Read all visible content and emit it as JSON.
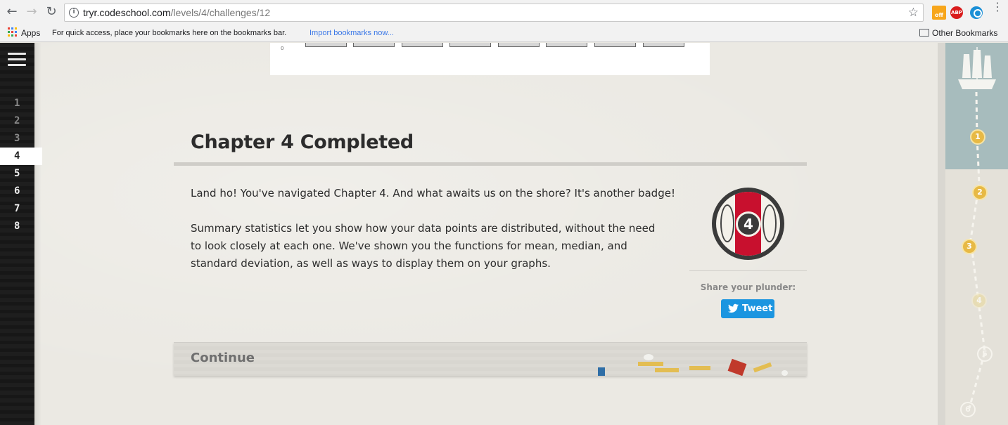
{
  "browser": {
    "url_host": "tryr.codeschool.com",
    "url_path": "/levels/4/challenges/12",
    "ext_off_label": "off",
    "ext_abp_label": "ABP"
  },
  "bookmarks": {
    "apps_label": "Apps",
    "hint": "For quick access, place your bookmarks here on the bookmarks bar.",
    "import_link": "Import bookmarks now...",
    "other": "Other Bookmarks"
  },
  "levels": {
    "items": [
      "1",
      "2",
      "3",
      "4",
      "5",
      "6",
      "7",
      "8"
    ],
    "active": "4"
  },
  "chart_strip": {
    "tick_label": "0"
  },
  "chapter": {
    "title": "Chapter 4 Completed",
    "intro": "Land ho! You've navigated Chapter 4. And what awaits us on the shore? It's another badge!",
    "summary": "Summary statistics let you show how your data points are distributed, without the need to look closely at each one. We've shown you the functions for mean, median, and standard deviation, as well as ways to display them on your graphs.",
    "badge_number": "4"
  },
  "share": {
    "label": "Share your plunder:",
    "tweet_label": "Tweet"
  },
  "continue": {
    "label": "Continue"
  },
  "map": {
    "nodes": [
      "1",
      "2",
      "3",
      "4",
      "5",
      "6"
    ]
  },
  "colors": {
    "tweet_blue": "#1b95e0",
    "badge_red": "#c8102e",
    "map_gold": "#e7b945"
  }
}
